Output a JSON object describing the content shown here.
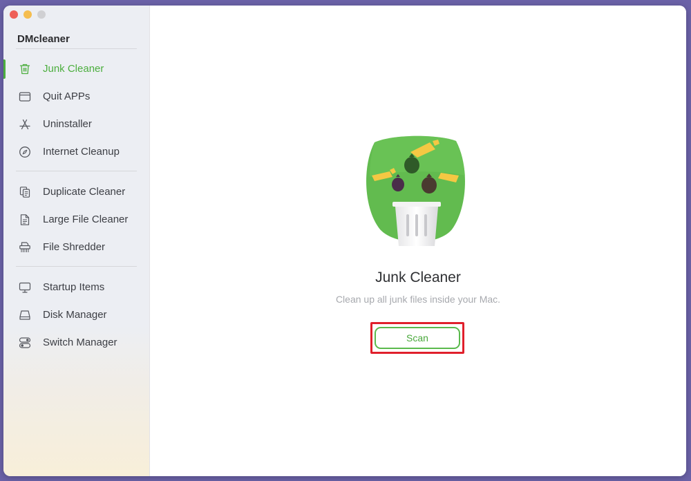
{
  "app": {
    "name": "DMcleaner"
  },
  "sidebar": {
    "items": [
      {
        "label": "Junk Cleaner",
        "icon": "trash-icon",
        "active": true
      },
      {
        "label": "Quit APPs",
        "icon": "window-icon",
        "active": false
      },
      {
        "label": "Uninstaller",
        "icon": "app-store-icon",
        "active": false
      },
      {
        "label": "Internet Cleanup",
        "icon": "compass-icon",
        "active": false
      },
      {
        "label": "Duplicate Cleaner",
        "icon": "duplicate-files-icon",
        "active": false
      },
      {
        "label": "Large File Cleaner",
        "icon": "document-icon",
        "active": false
      },
      {
        "label": "File Shredder",
        "icon": "shredder-icon",
        "active": false
      },
      {
        "label": "Startup Items",
        "icon": "monitor-icon",
        "active": false
      },
      {
        "label": "Disk Manager",
        "icon": "disk-icon",
        "active": false
      },
      {
        "label": "Switch Manager",
        "icon": "toggle-switch-icon",
        "active": false
      }
    ]
  },
  "main": {
    "title": "Junk Cleaner",
    "subtitle": "Clean up all junk files inside your Mac.",
    "scan_label": "Scan",
    "hero_icon": "junk-cleaner-illustration"
  },
  "colors": {
    "accent": "#4cae3e",
    "highlight": "#e0202c",
    "sidebar_bg": "#eceef3",
    "desktop_bg": "#6b62a8"
  }
}
